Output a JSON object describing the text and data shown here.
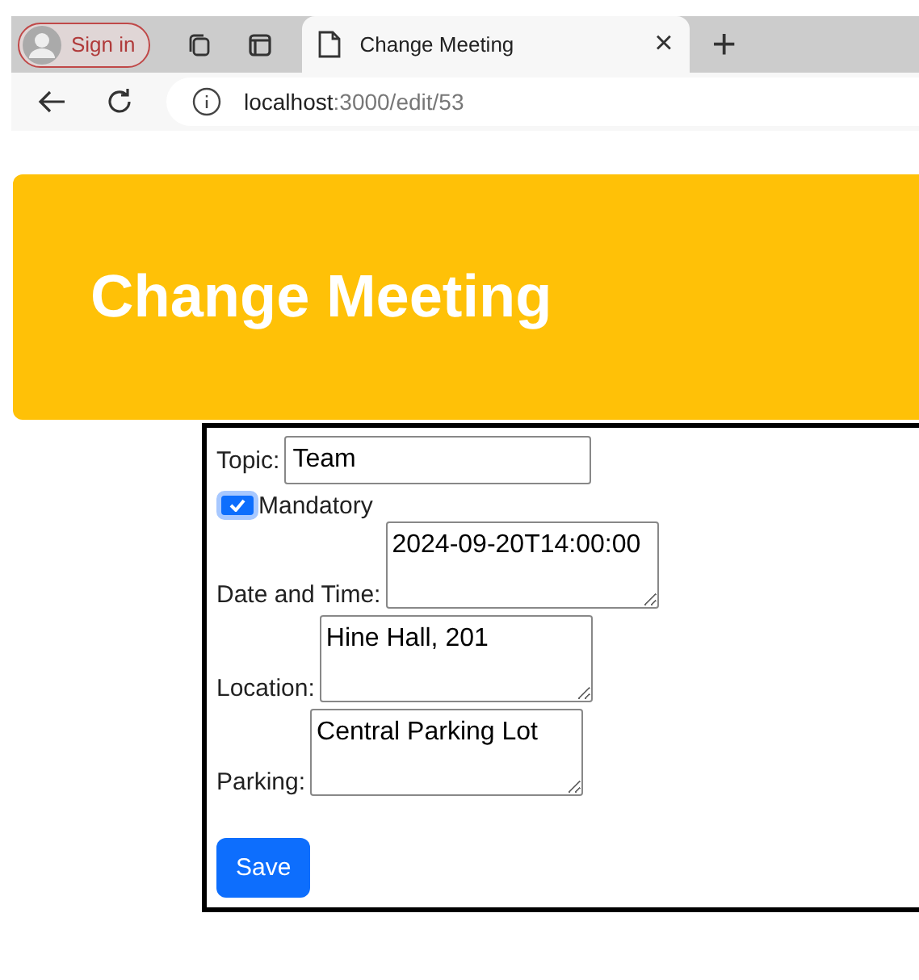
{
  "browser": {
    "sign_in": "Sign in",
    "tab": {
      "title": "Change Meeting",
      "close": "×",
      "selected": true
    },
    "new_tab": "+",
    "url_host": "localhost",
    "url_path": ":3000/edit/53"
  },
  "header": {
    "title": "Change Meeting"
  },
  "form": {
    "topic": {
      "label": "Topic:",
      "value": "Team"
    },
    "mandatory": {
      "label": "Mandatory",
      "checked": true
    },
    "fields": [
      {
        "label": "Date and Time:",
        "value": "2024-09-20T14:00:00"
      },
      {
        "label": "Location:",
        "value": "Hine Hall, 201"
      },
      {
        "label": "Parking:",
        "value": "Central Parking Lot"
      }
    ],
    "save": "Save"
  }
}
